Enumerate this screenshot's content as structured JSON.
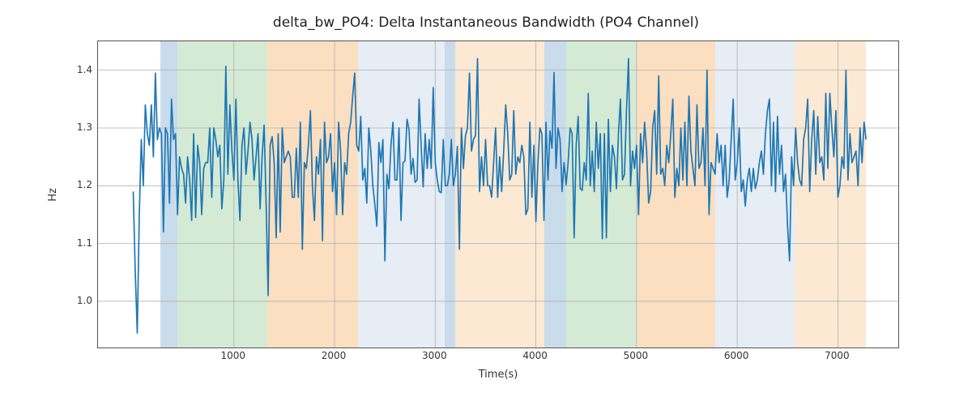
{
  "chart_data": {
    "type": "line",
    "title": "delta_bw_PO4: Delta Instantaneous Bandwidth (PO4 Channel)",
    "xlabel": "Time(s)",
    "ylabel": "Hz",
    "xlim": [
      -350,
      7600
    ],
    "ylim": [
      0.92,
      1.45
    ],
    "xticks": [
      1000,
      2000,
      3000,
      4000,
      5000,
      6000,
      7000
    ],
    "yticks": [
      1.0,
      1.1,
      1.2,
      1.3,
      1.4
    ],
    "background_spans": [
      {
        "x0": 270,
        "x1": 440,
        "color": "#c9dcec"
      },
      {
        "x0": 440,
        "x1": 1330,
        "color": "#d4ead4"
      },
      {
        "x0": 1330,
        "x1": 2230,
        "color": "#fbdfc0"
      },
      {
        "x0": 2230,
        "x1": 3090,
        "color": "#e6edf5"
      },
      {
        "x0": 3090,
        "x1": 3200,
        "color": "#c9dcec"
      },
      {
        "x0": 3200,
        "x1": 4080,
        "color": "#fce9d3"
      },
      {
        "x0": 4080,
        "x1": 4300,
        "color": "#c9dcec"
      },
      {
        "x0": 4300,
        "x1": 5000,
        "color": "#d4ead4"
      },
      {
        "x0": 5000,
        "x1": 5780,
        "color": "#fbdfc0"
      },
      {
        "x0": 5780,
        "x1": 6570,
        "color": "#e6edf5"
      },
      {
        "x0": 6570,
        "x1": 7280,
        "color": "#fce9d3"
      }
    ],
    "series": [
      {
        "name": "delta_bw_PO4",
        "x": [
          0,
          20,
          40,
          60,
          80,
          100,
          120,
          140,
          160,
          180,
          200,
          220,
          240,
          260,
          280,
          300,
          320,
          340,
          360,
          380,
          400,
          420,
          440,
          460,
          480,
          500,
          520,
          540,
          560,
          580,
          600,
          620,
          640,
          660,
          680,
          700,
          720,
          740,
          760,
          780,
          800,
          820,
          840,
          860,
          880,
          900,
          920,
          940,
          960,
          980,
          1000,
          1020,
          1040,
          1060,
          1080,
          1100,
          1120,
          1140,
          1160,
          1180,
          1200,
          1220,
          1240,
          1260,
          1280,
          1300,
          1320,
          1340,
          1360,
          1380,
          1400,
          1420,
          1440,
          1460,
          1480,
          1500,
          1520,
          1540,
          1560,
          1580,
          1600,
          1620,
          1640,
          1660,
          1680,
          1700,
          1720,
          1740,
          1760,
          1780,
          1800,
          1820,
          1840,
          1860,
          1880,
          1900,
          1920,
          1940,
          1960,
          1980,
          2000,
          2020,
          2040,
          2060,
          2080,
          2100,
          2120,
          2140,
          2160,
          2180,
          2200,
          2220,
          2240,
          2260,
          2280,
          2300,
          2320,
          2340,
          2360,
          2380,
          2400,
          2420,
          2440,
          2460,
          2480,
          2500,
          2520,
          2540,
          2560,
          2580,
          2600,
          2620,
          2640,
          2660,
          2680,
          2700,
          2720,
          2740,
          2760,
          2780,
          2800,
          2820,
          2840,
          2860,
          2880,
          2900,
          2920,
          2940,
          2960,
          2980,
          3000,
          3020,
          3040,
          3060,
          3080,
          3100,
          3120,
          3140,
          3160,
          3180,
          3200,
          3220,
          3240,
          3260,
          3280,
          3300,
          3320,
          3340,
          3360,
          3380,
          3400,
          3420,
          3440,
          3460,
          3480,
          3500,
          3520,
          3540,
          3560,
          3580,
          3600,
          3620,
          3640,
          3660,
          3680,
          3700,
          3720,
          3740,
          3760,
          3780,
          3800,
          3820,
          3840,
          3860,
          3880,
          3900,
          3920,
          3940,
          3960,
          3980,
          4000,
          4020,
          4040,
          4060,
          4080,
          4100,
          4120,
          4140,
          4160,
          4180,
          4200,
          4220,
          4240,
          4260,
          4280,
          4300,
          4320,
          4340,
          4360,
          4380,
          4400,
          4420,
          4440,
          4460,
          4480,
          4500,
          4520,
          4540,
          4560,
          4580,
          4600,
          4620,
          4640,
          4660,
          4680,
          4700,
          4720,
          4740,
          4760,
          4780,
          4800,
          4820,
          4840,
          4860,
          4880,
          4900,
          4920,
          4940,
          4960,
          4980,
          5000,
          5020,
          5040,
          5060,
          5080,
          5100,
          5120,
          5140,
          5160,
          5180,
          5200,
          5220,
          5240,
          5260,
          5280,
          5300,
          5320,
          5340,
          5360,
          5380,
          5400,
          5420,
          5440,
          5460,
          5480,
          5500,
          5520,
          5540,
          5560,
          5580,
          5600,
          5620,
          5640,
          5660,
          5680,
          5700,
          5720,
          5740,
          5760,
          5780,
          5800,
          5820,
          5840,
          5860,
          5880,
          5900,
          5920,
          5940,
          5960,
          5980,
          6000,
          6020,
          6040,
          6060,
          6080,
          6100,
          6120,
          6140,
          6160,
          6180,
          6200,
          6220,
          6240,
          6260,
          6280,
          6300,
          6320,
          6340,
          6360,
          6380,
          6400,
          6420,
          6440,
          6460,
          6480,
          6500,
          6520,
          6540,
          6560,
          6580,
          6600,
          6620,
          6640,
          6660,
          6680,
          6700,
          6720,
          6740,
          6760,
          6780,
          6800,
          6820,
          6840,
          6860,
          6880,
          6900,
          6920,
          6940,
          6960,
          6980,
          7000,
          7020,
          7040,
          7060,
          7080,
          7100,
          7120,
          7140,
          7160,
          7180,
          7200,
          7220,
          7240,
          7260,
          7280
        ],
        "y": [
          1.19,
          1.05,
          0.945,
          1.15,
          1.28,
          1.2,
          1.34,
          1.29,
          1.27,
          1.34,
          1.25,
          1.395,
          1.28,
          1.3,
          1.29,
          1.12,
          1.3,
          1.29,
          1.17,
          1.35,
          1.28,
          1.29,
          1.15,
          1.25,
          1.23,
          1.22,
          1.17,
          1.25,
          1.21,
          1.14,
          1.29,
          1.145,
          1.27,
          1.24,
          1.15,
          1.23,
          1.24,
          1.24,
          1.3,
          1.18,
          1.3,
          1.28,
          1.25,
          1.27,
          1.16,
          1.21,
          1.407,
          1.22,
          1.34,
          1.26,
          1.21,
          1.35,
          1.21,
          1.14,
          1.27,
          1.3,
          1.22,
          1.26,
          1.31,
          1.28,
          1.21,
          1.25,
          1.29,
          1.16,
          1.25,
          1.305,
          1.17,
          1.01,
          1.27,
          1.285,
          1.24,
          1.11,
          1.29,
          1.12,
          1.3,
          1.24,
          1.25,
          1.26,
          1.25,
          1.18,
          1.18,
          1.265,
          1.18,
          1.31,
          1.09,
          1.24,
          1.23,
          1.27,
          1.33,
          1.2,
          1.14,
          1.25,
          1.22,
          1.28,
          1.105,
          1.31,
          1.24,
          1.25,
          1.29,
          1.19,
          1.24,
          1.15,
          1.31,
          1.26,
          1.15,
          1.24,
          1.22,
          1.29,
          1.31,
          1.355,
          1.395,
          1.27,
          1.26,
          1.32,
          1.21,
          1.23,
          1.17,
          1.3,
          1.26,
          1.2,
          1.168,
          1.13,
          1.275,
          1.24,
          1.28,
          1.07,
          1.22,
          1.195,
          1.27,
          1.31,
          1.21,
          1.21,
          1.3,
          1.14,
          1.24,
          1.243,
          1.315,
          1.297,
          1.22,
          1.247,
          1.206,
          1.21,
          1.35,
          1.27,
          1.198,
          1.29,
          1.23,
          1.28,
          1.23,
          1.37,
          1.24,
          1.21,
          1.19,
          1.188,
          1.28,
          1.2,
          1.2,
          1.22,
          1.28,
          1.2,
          1.22,
          1.268,
          1.09,
          1.3,
          1.23,
          1.286,
          1.3,
          1.395,
          1.26,
          1.28,
          1.287,
          1.42,
          1.19,
          1.25,
          1.2,
          1.28,
          1.2,
          1.2,
          1.18,
          1.24,
          1.3,
          1.18,
          1.25,
          1.19,
          1.26,
          1.34,
          1.29,
          1.21,
          1.22,
          1.33,
          1.22,
          1.25,
          1.24,
          1.27,
          1.25,
          1.15,
          1.16,
          1.31,
          1.18,
          1.27,
          1.138,
          1.24,
          1.3,
          1.29,
          1.14,
          1.31,
          1.21,
          1.295,
          1.265,
          1.396,
          1.23,
          1.3,
          1.28,
          1.19,
          1.24,
          1.202,
          1.24,
          1.3,
          1.29,
          1.11,
          1.27,
          1.32,
          1.195,
          1.192,
          1.24,
          1.21,
          1.36,
          1.2,
          1.26,
          1.19,
          1.31,
          1.23,
          1.29,
          1.108,
          1.29,
          1.11,
          1.315,
          1.19,
          1.27,
          1.25,
          1.195,
          1.29,
          1.35,
          1.21,
          1.22,
          1.33,
          1.42,
          1.2,
          1.26,
          1.23,
          1.27,
          1.15,
          1.29,
          1.24,
          1.31,
          1.26,
          1.17,
          1.19,
          1.3,
          1.33,
          1.22,
          1.39,
          1.22,
          1.23,
          1.2,
          1.27,
          1.24,
          1.29,
          1.35,
          1.18,
          1.23,
          1.2,
          1.3,
          1.21,
          1.31,
          1.2,
          1.355,
          1.26,
          1.23,
          1.2,
          1.34,
          1.23,
          1.24,
          1.3,
          1.2,
          1.4,
          1.15,
          1.24,
          1.23,
          1.22,
          1.29,
          1.24,
          1.27,
          1.2,
          1.27,
          1.18,
          1.21,
          1.28,
          1.35,
          1.21,
          1.24,
          1.3,
          1.19,
          1.21,
          1.165,
          1.21,
          1.23,
          1.19,
          1.23,
          1.195,
          1.21,
          1.24,
          1.26,
          1.22,
          1.29,
          1.33,
          1.35,
          1.2,
          1.31,
          1.19,
          1.32,
          1.22,
          1.27,
          1.19,
          1.22,
          1.13,
          1.07,
          1.25,
          1.2,
          1.3,
          1.24,
          1.21,
          1.2,
          1.28,
          1.3,
          1.35,
          1.19,
          1.28,
          1.33,
          1.22,
          1.32,
          1.24,
          1.25,
          1.21,
          1.36,
          1.23,
          1.36,
          1.3,
          1.25,
          1.33,
          1.18,
          1.2,
          1.25,
          1.23,
          1.4,
          1.21,
          1.29,
          1.24,
          1.25,
          1.26,
          1.2,
          1.3,
          1.24,
          1.31,
          1.28
        ]
      }
    ]
  }
}
